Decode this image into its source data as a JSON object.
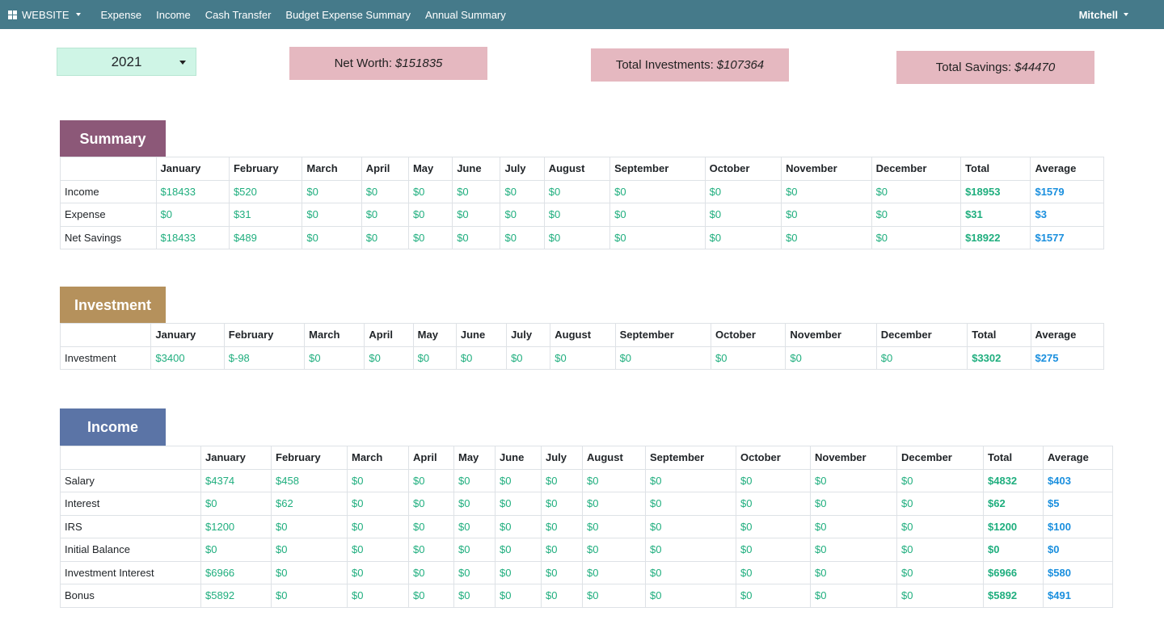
{
  "nav": {
    "brand": "WEBSITE",
    "links": [
      "Expense",
      "Income",
      "Cash Transfer",
      "Budget Expense Summary",
      "Annual Summary"
    ],
    "user": "Mitchell"
  },
  "year_select": {
    "value": "2021"
  },
  "stats": {
    "net_worth": {
      "label": "Net Worth:",
      "value": "$151835"
    },
    "investments": {
      "label": "Total Investments:",
      "value": "$107364"
    },
    "savings": {
      "label": "Total Savings:",
      "value": "$44470"
    }
  },
  "columns": [
    "January",
    "February",
    "March",
    "April",
    "May",
    "June",
    "July",
    "August",
    "September",
    "October",
    "November",
    "December",
    "Total",
    "Average"
  ],
  "summary": {
    "title": "Summary",
    "rows": [
      {
        "label": "Income",
        "cells": [
          "$18433",
          "$520",
          "$0",
          "$0",
          "$0",
          "$0",
          "$0",
          "$0",
          "$0",
          "$0",
          "$0",
          "$0"
        ],
        "total": "$18953",
        "avg": "$1579"
      },
      {
        "label": "Expense",
        "cells": [
          "$0",
          "$31",
          "$0",
          "$0",
          "$0",
          "$0",
          "$0",
          "$0",
          "$0",
          "$0",
          "$0",
          "$0"
        ],
        "total": "$31",
        "avg": "$3"
      },
      {
        "label": "Net Savings",
        "cells": [
          "$18433",
          "$489",
          "$0",
          "$0",
          "$0",
          "$0",
          "$0",
          "$0",
          "$0",
          "$0",
          "$0",
          "$0"
        ],
        "total": "$18922",
        "avg": "$1577"
      }
    ]
  },
  "investment": {
    "title": "Investment",
    "rows": [
      {
        "label": "Investment",
        "cells": [
          "$3400",
          "$-98",
          "$0",
          "$0",
          "$0",
          "$0",
          "$0",
          "$0",
          "$0",
          "$0",
          "$0",
          "$0"
        ],
        "total": "$3302",
        "avg": "$275"
      }
    ]
  },
  "income": {
    "title": "Income",
    "rows": [
      {
        "label": "Salary",
        "cells": [
          "$4374",
          "$458",
          "$0",
          "$0",
          "$0",
          "$0",
          "$0",
          "$0",
          "$0",
          "$0",
          "$0",
          "$0"
        ],
        "total": "$4832",
        "avg": "$403"
      },
      {
        "label": "Interest",
        "cells": [
          "$0",
          "$62",
          "$0",
          "$0",
          "$0",
          "$0",
          "$0",
          "$0",
          "$0",
          "$0",
          "$0",
          "$0"
        ],
        "total": "$62",
        "avg": "$5"
      },
      {
        "label": "IRS",
        "cells": [
          "$1200",
          "$0",
          "$0",
          "$0",
          "$0",
          "$0",
          "$0",
          "$0",
          "$0",
          "$0",
          "$0",
          "$0"
        ],
        "total": "$1200",
        "avg": "$100"
      },
      {
        "label": "Initial Balance",
        "cells": [
          "$0",
          "$0",
          "$0",
          "$0",
          "$0",
          "$0",
          "$0",
          "$0",
          "$0",
          "$0",
          "$0",
          "$0"
        ],
        "total": "$0",
        "avg": "$0"
      },
      {
        "label": "Investment Interest",
        "cells": [
          "$6966",
          "$0",
          "$0",
          "$0",
          "$0",
          "$0",
          "$0",
          "$0",
          "$0",
          "$0",
          "$0",
          "$0"
        ],
        "total": "$6966",
        "avg": "$580"
      },
      {
        "label": "Bonus",
        "cells": [
          "$5892",
          "$0",
          "$0",
          "$0",
          "$0",
          "$0",
          "$0",
          "$0",
          "$0",
          "$0",
          "$0",
          "$0"
        ],
        "total": "$5892",
        "avg": "$491"
      }
    ]
  }
}
